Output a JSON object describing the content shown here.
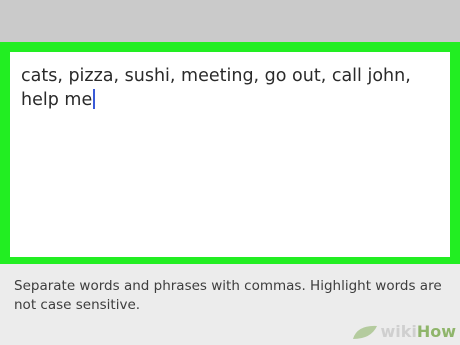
{
  "editor": {
    "text": "cats, pizza, sushi, meeting, go out, call john, help me"
  },
  "help": {
    "text": "Separate words and phrases with commas. Highlight words are not case sensitive."
  },
  "watermark": {
    "part1": "wiki",
    "part2": "How"
  },
  "colors": {
    "highlight": "#22ee22",
    "caret": "#3a5bd8"
  }
}
